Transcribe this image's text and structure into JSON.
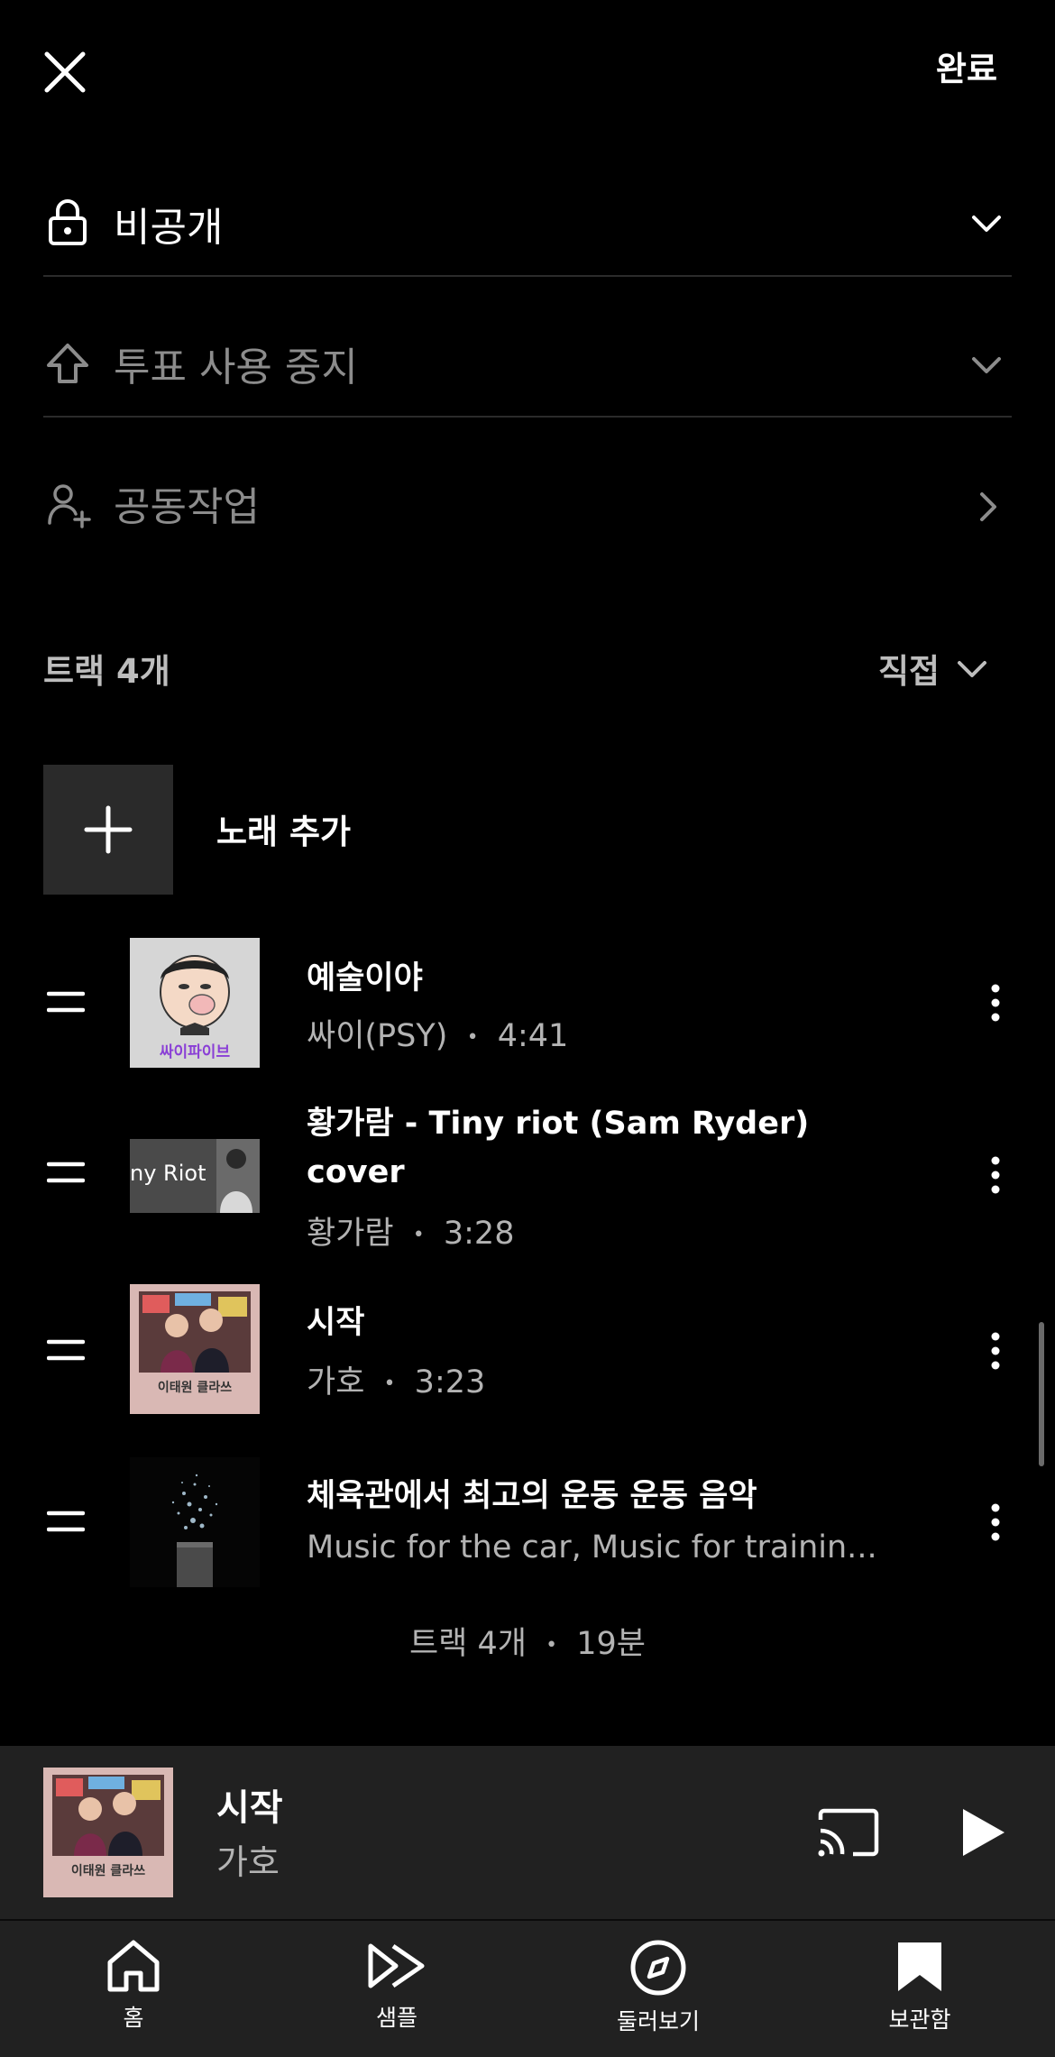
{
  "header": {
    "done_label": "완료"
  },
  "settings": {
    "privacy": {
      "label": "비공개"
    },
    "voting": {
      "label": "투표 사용 중지"
    },
    "collaborate": {
      "label": "공동작업"
    }
  },
  "tracks_header": {
    "count_label": "트랙 4개",
    "sort_label": "직접"
  },
  "add_song": {
    "label": "노래 추가"
  },
  "tracks": [
    {
      "title": "예술이야",
      "artist": "싸이(PSY)",
      "duration": "4:41",
      "art_text": "싸이파이브"
    },
    {
      "title_line1": "황가람 - Tiny riot (Sam Ryder)",
      "title_line2": "cover",
      "artist": "황가람",
      "duration": "3:28",
      "art_text": "ny Riot"
    },
    {
      "title": "시작",
      "artist": "가호",
      "duration": "3:23",
      "art_text": "이태원 클라쓰"
    },
    {
      "title": "체육관에서 최고의 운동 운동 음악",
      "subtitle": "Music for the car, Music for trainin..."
    }
  ],
  "summary": {
    "count": "트랙 4개",
    "total": "19분"
  },
  "separator": "•",
  "now_playing": {
    "title": "시작",
    "artist": "가호",
    "art_text": "이태원 클라쓰"
  },
  "nav": {
    "home": "홈",
    "samples": "샘플",
    "explore": "둘러보기",
    "library": "보관함"
  },
  "colors": {
    "background": "#000000",
    "player_bar": "#212121",
    "add_tile": "#2a2a2a",
    "accent_purple": "#8a3fd6"
  }
}
